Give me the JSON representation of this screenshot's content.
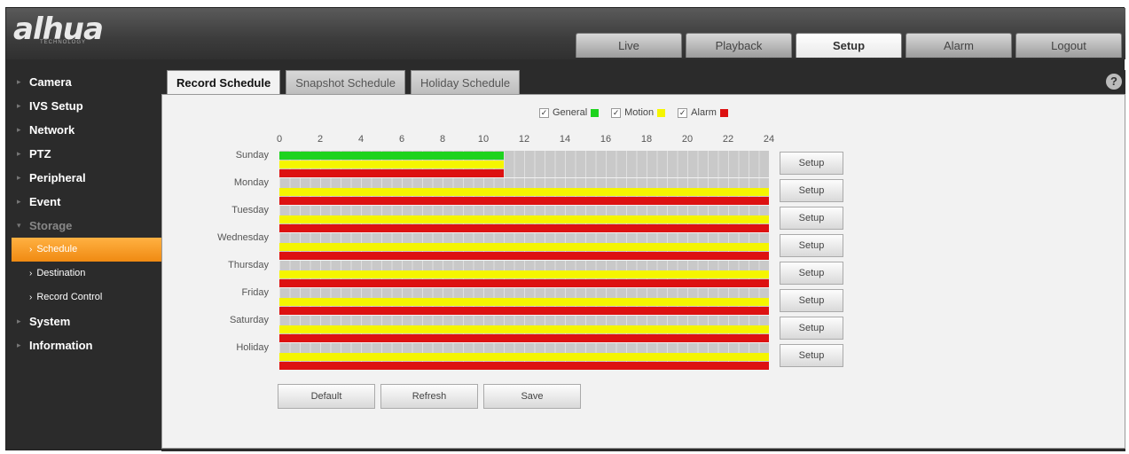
{
  "brand": {
    "logo_text": "alhua",
    "logo_sub": "TECHNOLOGY"
  },
  "top_nav": [
    {
      "label": "Live",
      "active": false
    },
    {
      "label": "Playback",
      "active": false
    },
    {
      "label": "Setup",
      "active": true
    },
    {
      "label": "Alarm",
      "active": false
    },
    {
      "label": "Logout",
      "active": false
    }
  ],
  "sidebar": {
    "items": [
      {
        "label": "Camera"
      },
      {
        "label": "IVS Setup"
      },
      {
        "label": "Network"
      },
      {
        "label": "PTZ"
      },
      {
        "label": "Peripheral"
      },
      {
        "label": "Event"
      },
      {
        "label": "Storage",
        "expanded": true
      },
      {
        "label": "Schedule",
        "sub": true,
        "active": true
      },
      {
        "label": "Destination",
        "sub": true
      },
      {
        "label": "Record Control",
        "sub": true
      },
      {
        "label": "System"
      },
      {
        "label": "Information"
      }
    ]
  },
  "tabs": [
    {
      "label": "Record Schedule",
      "active": true
    },
    {
      "label": "Snapshot Schedule",
      "active": false
    },
    {
      "label": "Holiday Schedule",
      "active": false
    }
  ],
  "help_icon": "?",
  "legend": [
    {
      "label": "General",
      "checked": true,
      "color": "#1ed31e"
    },
    {
      "label": "Motion",
      "checked": true,
      "color": "#f5f500"
    },
    {
      "label": "Alarm",
      "checked": true,
      "color": "#dd1111"
    }
  ],
  "hour_ticks": [
    "0",
    "2",
    "4",
    "6",
    "8",
    "10",
    "12",
    "14",
    "16",
    "18",
    "20",
    "22",
    "24"
  ],
  "schedule": [
    {
      "day": "Sunday",
      "general_end_hour": 11,
      "motion_end_hour": 11,
      "alarm_end_hour": 11
    },
    {
      "day": "Monday",
      "general_end_hour": 0,
      "motion_end_hour": 24,
      "alarm_end_hour": 24
    },
    {
      "day": "Tuesday",
      "general_end_hour": 0,
      "motion_end_hour": 24,
      "alarm_end_hour": 24
    },
    {
      "day": "Wednesday",
      "general_end_hour": 0,
      "motion_end_hour": 24,
      "alarm_end_hour": 24
    },
    {
      "day": "Thursday",
      "general_end_hour": 0,
      "motion_end_hour": 24,
      "alarm_end_hour": 24
    },
    {
      "day": "Friday",
      "general_end_hour": 0,
      "motion_end_hour": 24,
      "alarm_end_hour": 24
    },
    {
      "day": "Saturday",
      "general_end_hour": 0,
      "motion_end_hour": 24,
      "alarm_end_hour": 24
    },
    {
      "day": "Holiday",
      "general_end_hour": 0,
      "motion_end_hour": 24,
      "alarm_end_hour": 24
    }
  ],
  "setup_label": "Setup",
  "actions": {
    "default_label": "Default",
    "refresh_label": "Refresh",
    "save_label": "Save"
  }
}
